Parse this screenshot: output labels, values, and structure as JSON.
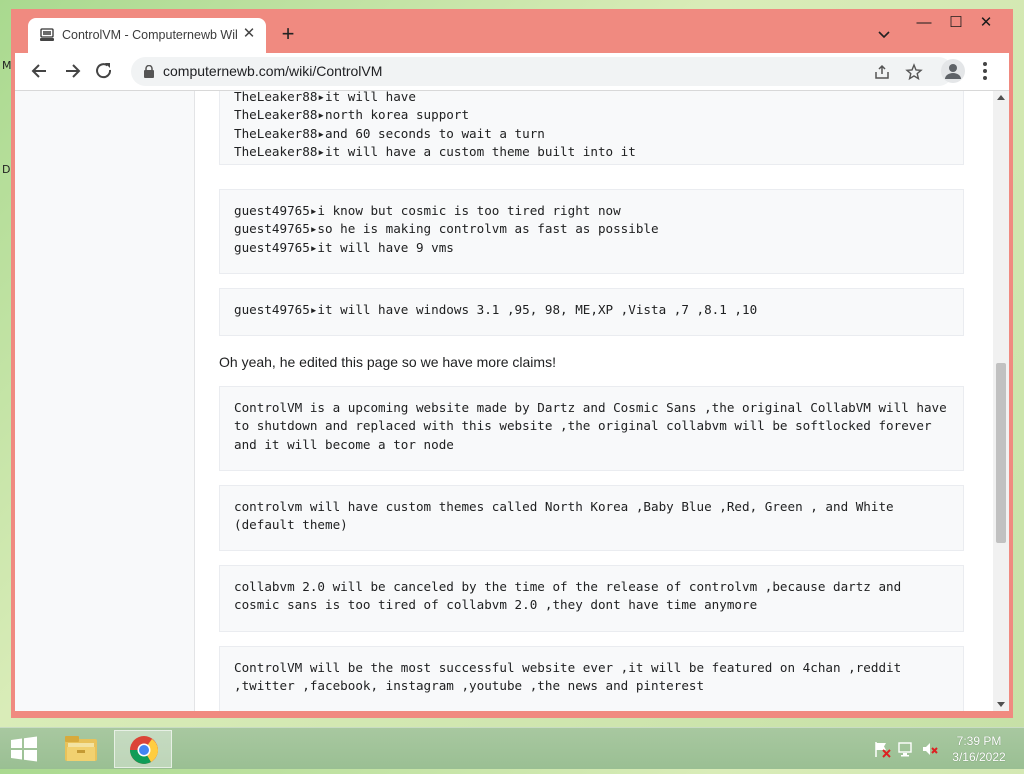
{
  "desktop": {
    "letter_m": "M",
    "letter_d": "D"
  },
  "browser": {
    "tab": {
      "title": "ControlVM - Computernewb Wiki",
      "close": "✕"
    },
    "new_tab": "+",
    "window_controls": {
      "minimize": "—",
      "maximize": "☐",
      "close": "✕"
    },
    "url": "computernewb.com/wiki/ControlVM",
    "icons": [
      "back-icon",
      "forward-icon",
      "reload-icon",
      "lock-icon",
      "share-icon",
      "star-icon",
      "profile-icon",
      "menu-icon",
      "tab-search-icon"
    ]
  },
  "page": {
    "block1": {
      "lines": [
        "TheLeaker88▸it will have",
        "TheLeaker88▸north korea support",
        "TheLeaker88▸and 60 seconds to wait a turn",
        "TheLeaker88▸it will have a custom theme built into it"
      ]
    },
    "block2": {
      "lines": [
        "guest49765▸i know but cosmic is too tired right now",
        "guest49765▸so he is making controlvm as fast as possible",
        "guest49765▸it will have 9 vms"
      ]
    },
    "block3": {
      "lines": [
        "guest49765▸it will have windows 3.1 ,95, 98, ME,XP ,Vista ,7 ,8.1 ,10"
      ]
    },
    "paragraph": "Oh yeah, he edited this page so we have more claims!",
    "block4": "ControlVM is a upcoming website made by Dartz and Cosmic Sans ,the original CollabVM will have to shutdown and replaced with this website ,the original collabvm will be softlocked forever and it will become a tor node",
    "block5": "controlvm will have custom themes called North Korea ,Baby Blue ,Red, Green , and White (default theme)",
    "block6": "collabvm 2.0 will be canceled by the time of the release of controlvm ,because dartz and cosmic sans is too tired of collabvm 2.0 ,they dont have time anymore",
    "block7": "ControlVM will be the most successful website ever ,it will be featured on 4chan ,reddit ,twitter ,facebook, instagram ,youtube ,the news and pinterest"
  },
  "taskbar": {
    "clock_time": "7:39 PM",
    "clock_date": "3/16/2022",
    "items": [
      "start-button",
      "file-explorer",
      "chrome"
    ]
  },
  "colors": {
    "window_frame": "#f08a80",
    "taskbar": "#9abf93",
    "code_bg": "#f8f9fa"
  }
}
